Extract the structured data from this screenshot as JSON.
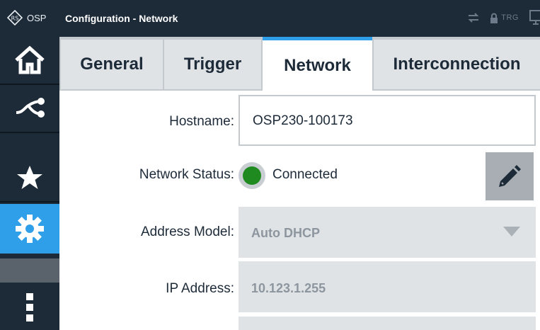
{
  "titlebar": {
    "brand": "OSP",
    "title": "Configuration - Network",
    "trg_label": "TRG"
  },
  "sidebar": {
    "items": [
      {
        "icon": "home-icon"
      },
      {
        "icon": "route-icon"
      },
      {
        "icon": "star-icon"
      },
      {
        "icon": "gear-icon",
        "active": true
      },
      {
        "icon": "more-vertical-icon"
      }
    ]
  },
  "tabs": [
    {
      "label": "General"
    },
    {
      "label": "Trigger"
    },
    {
      "label": "Network",
      "active": true
    },
    {
      "label": "Interconnection"
    }
  ],
  "form": {
    "hostname_label": "Hostname:",
    "hostname_value": "OSP230-100173",
    "network_status_label": "Network Status:",
    "network_status_value": "Connected",
    "address_model_label": "Address Model:",
    "address_model_value": "Auto DHCP",
    "ip_address_label": "IP Address:",
    "ip_address_value": "10.123.1.255"
  },
  "colors": {
    "accent": "#2e9fe8",
    "dark": "#1d2a38",
    "connected": "#1f8a1f"
  }
}
